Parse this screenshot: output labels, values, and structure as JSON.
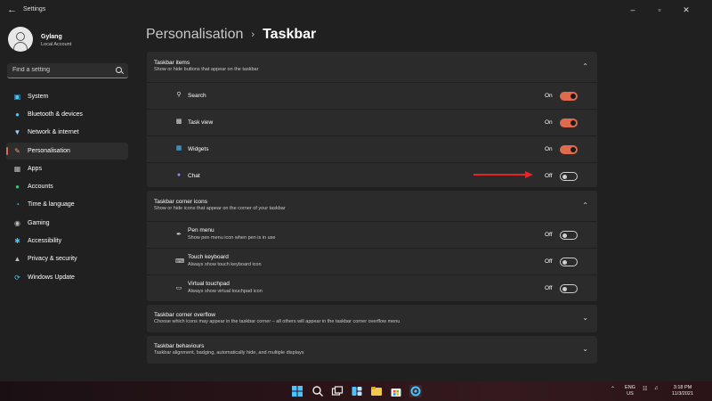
{
  "app": {
    "title": "Settings",
    "back_icon": "back-arrow-icon",
    "controls": [
      "minimize-icon",
      "maximize-icon",
      "close-icon"
    ]
  },
  "profile": {
    "name": "Gylang",
    "account_type": "Local Account"
  },
  "search": {
    "placeholder": "Find a setting"
  },
  "sidebar": {
    "items": [
      {
        "label": "System",
        "icon": "system-icon",
        "color": "#4cc2ff"
      },
      {
        "label": "Bluetooth & devices",
        "icon": "bluetooth-icon",
        "color": "#4cc2ff"
      },
      {
        "label": "Network & internet",
        "icon": "network-icon",
        "color": "#a0d0ff"
      },
      {
        "label": "Personalisation",
        "icon": "brush-icon",
        "color": "#e8a070",
        "active": true
      },
      {
        "label": "Apps",
        "icon": "apps-icon",
        "color": "#bbbbbb"
      },
      {
        "label": "Accounts",
        "icon": "accounts-icon",
        "color": "#3fc27a"
      },
      {
        "label": "Time & language",
        "icon": "globe-clock-icon",
        "color": "#4cc2ff"
      },
      {
        "label": "Gaming",
        "icon": "gamepad-icon",
        "color": "#bbbbbb"
      },
      {
        "label": "Accessibility",
        "icon": "accessibility-icon",
        "color": "#4cc2ff"
      },
      {
        "label": "Privacy & security",
        "icon": "shield-icon",
        "color": "#bbbbbb"
      },
      {
        "label": "Windows Update",
        "icon": "update-icon",
        "color": "#4cc2ff"
      }
    ]
  },
  "breadcrumb": {
    "parent": "Personalisation",
    "separator": "›",
    "current": "Taskbar"
  },
  "sections": {
    "items": {
      "title": "Taskbar items",
      "subtitle": "Show or hide buttons that appear on the taskbar",
      "rows": [
        {
          "label": "Search",
          "state": "On",
          "icon": "search-icon"
        },
        {
          "label": "Task view",
          "state": "On",
          "icon": "task-view-icon"
        },
        {
          "label": "Widgets",
          "state": "On",
          "icon": "widgets-icon"
        },
        {
          "label": "Chat",
          "state": "Off",
          "icon": "chat-icon"
        }
      ]
    },
    "corner_icons": {
      "title": "Taskbar corner icons",
      "subtitle": "Show or hide icons that appear on the corner of your taskbar",
      "rows": [
        {
          "label": "Pen menu",
          "sub": "Show pen menu icon when pen is in use",
          "state": "Off",
          "icon": "pen-icon"
        },
        {
          "label": "Touch keyboard",
          "sub": "Always show touch keyboard icon",
          "state": "Off",
          "icon": "keyboard-icon"
        },
        {
          "label": "Virtual touchpad",
          "sub": "Always show virtual touchpad icon",
          "state": "Off",
          "icon": "touchpad-icon"
        }
      ]
    },
    "corner_overflow": {
      "title": "Taskbar corner overflow",
      "subtitle": "Choose which icons may appear in the taskbar corner – all others will appear in the taskbar corner overflow menu"
    },
    "behaviours": {
      "title": "Taskbar behaviours",
      "subtitle": "Taskbar alignment, badging, automatically hide, and multiple displays"
    }
  },
  "annotation": {
    "color": "#e0262b"
  },
  "taskbar": {
    "apps": [
      "start-icon",
      "search-icon",
      "task-view-icon",
      "widgets-icon",
      "chat-icon",
      "file-explorer-icon",
      "store-icon",
      "settings-icon"
    ],
    "tray": {
      "lang_line1": "ENG",
      "lang_line2": "US",
      "time": "3:18 PM",
      "date": "11/3/2021"
    }
  }
}
